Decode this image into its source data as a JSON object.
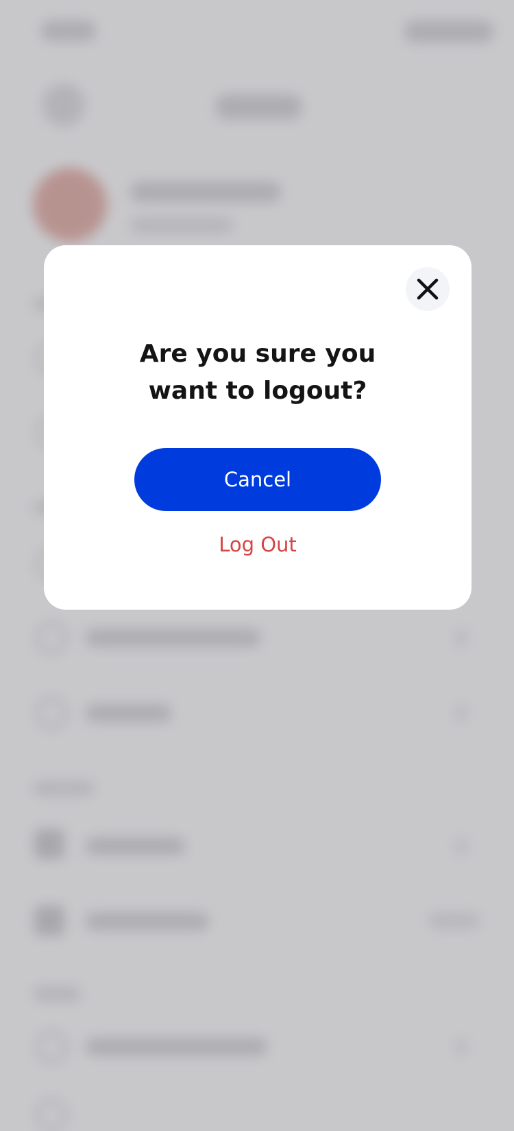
{
  "logout_dialog": {
    "close_icon": "close-icon",
    "title": "Are you sure you want to logout?",
    "cancel_label": "Cancel",
    "logout_label": "Log Out"
  },
  "colors": {
    "primary": "#003bde",
    "danger": "#d64444",
    "overlay": "#c8c8cb",
    "close_bg": "#f3f4f8"
  }
}
